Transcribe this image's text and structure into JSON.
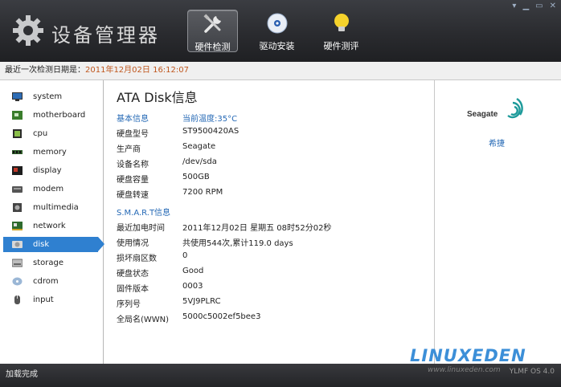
{
  "app": {
    "title": "设备管理器"
  },
  "nav": [
    {
      "label": "硬件检测",
      "icon": "tools-icon",
      "active": true
    },
    {
      "label": "驱动安装",
      "icon": "disc-icon",
      "active": false
    },
    {
      "label": "硬件测评",
      "icon": "bulb-icon",
      "active": false
    }
  ],
  "datebar": {
    "label": "最近一次检测日期是：",
    "value": "2011年12月02日 16:12:07"
  },
  "sidebar": {
    "items": [
      {
        "label": "system",
        "icon": "monitor-icon"
      },
      {
        "label": "motherboard",
        "icon": "motherboard-icon"
      },
      {
        "label": "cpu",
        "icon": "cpu-icon"
      },
      {
        "label": "memory",
        "icon": "memory-icon"
      },
      {
        "label": "display",
        "icon": "display-card-icon"
      },
      {
        "label": "modem",
        "icon": "modem-icon"
      },
      {
        "label": "multimedia",
        "icon": "multimedia-icon"
      },
      {
        "label": "network",
        "icon": "network-card-icon"
      },
      {
        "label": "disk",
        "icon": "disk-icon",
        "active": true
      },
      {
        "label": "storage",
        "icon": "storage-icon"
      },
      {
        "label": "cdrom",
        "icon": "cdrom-icon"
      },
      {
        "label": "input",
        "icon": "input-icon"
      }
    ]
  },
  "main": {
    "title": "ATA Disk信息",
    "basic": {
      "heading": "基本信息",
      "temperature": "当前温度:35°C",
      "rows": [
        {
          "label": "硬盘型号",
          "value": "ST9500420AS"
        },
        {
          "label": "生产商",
          "value": "Seagate"
        },
        {
          "label": "设备名称",
          "value": "/dev/sda"
        },
        {
          "label": "硬盘容量",
          "value": "500GB"
        },
        {
          "label": "硬盘转速",
          "value": "7200 RPM"
        }
      ]
    },
    "smart": {
      "heading": "S.M.A.R.T信息",
      "rows": [
        {
          "label": "最近加电时间",
          "value": "2011年12月02日 星期五 08时52分02秒"
        },
        {
          "label": "使用情况",
          "value": "共使用544次,累计119.0 days"
        },
        {
          "label": "损坏扇区数",
          "value": "0"
        },
        {
          "label": "硬盘状态",
          "value": "Good"
        },
        {
          "label": "固件版本",
          "value": "0003"
        },
        {
          "label": "序列号",
          "value": "5VJ9PLRC"
        },
        {
          "label": "全局名(WWN)",
          "value": "5000c5002ef5bee3"
        }
      ]
    }
  },
  "brand": {
    "logo_text": "Seagate",
    "name": "希捷"
  },
  "status": {
    "text": "加载完成"
  },
  "watermark": {
    "logo": "LINUXEDEN",
    "url": "www.linuxeden.com",
    "version": "YLMF OS 4.0"
  },
  "colors": {
    "accent": "#2f80d0",
    "link": "#2468b5",
    "date": "#c0571e"
  }
}
